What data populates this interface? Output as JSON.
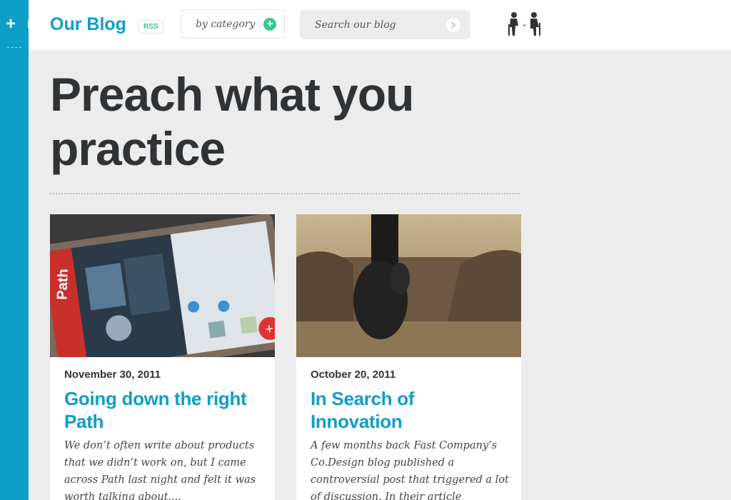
{
  "site": {
    "brand": "Our Blog",
    "rss_label": "RSS",
    "category_label": "by category",
    "search_placeholder": "Search our blog"
  },
  "page": {
    "title": "Preach what you practice"
  },
  "posts": [
    {
      "date": "November 30, 2011",
      "title": "Going down the right Path",
      "excerpt": "We don’t often write about products that we didn’t work on, but I came across Path last night and felt it was worth talking about...."
    },
    {
      "date": "October 20, 2011",
      "title": "In Search of Innovation",
      "excerpt": "A few months back Fast Company’s Co.Design blog published a controversial post that triggered a lot of discussion. In their article"
    }
  ],
  "colors": {
    "accent": "#0d9ec8",
    "green": "#3cc58f",
    "title": "#2f3336",
    "background": "#ececec"
  }
}
